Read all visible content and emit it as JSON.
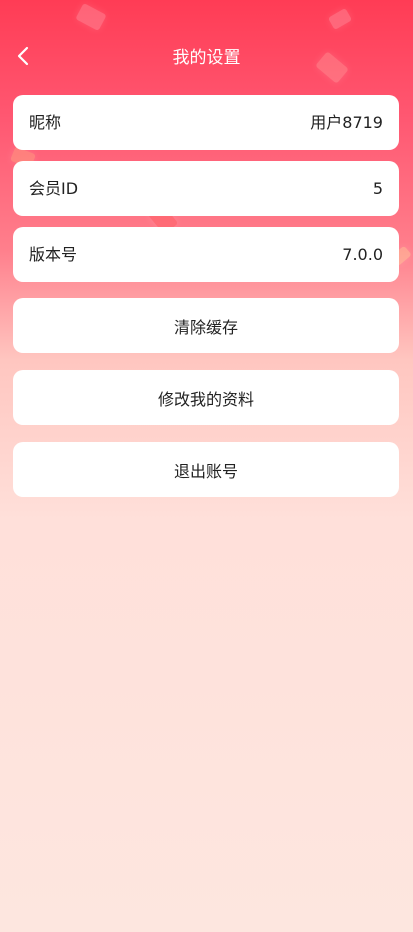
{
  "header": {
    "title": "我的设置",
    "back_icon": "chevron-left-icon"
  },
  "info": [
    {
      "label": "昵称",
      "value": "用户8719"
    },
    {
      "label": "会员ID",
      "value": "5"
    },
    {
      "label": "版本号",
      "value": "7.0.0"
    }
  ],
  "actions": {
    "clear_cache": "清除缓存",
    "edit_profile": "修改我的资料",
    "logout": "退出账号"
  },
  "colors": {
    "header_red": "#ff3c55",
    "background_pink": "#fde6df",
    "card": "#ffffff",
    "text": "#222222"
  }
}
